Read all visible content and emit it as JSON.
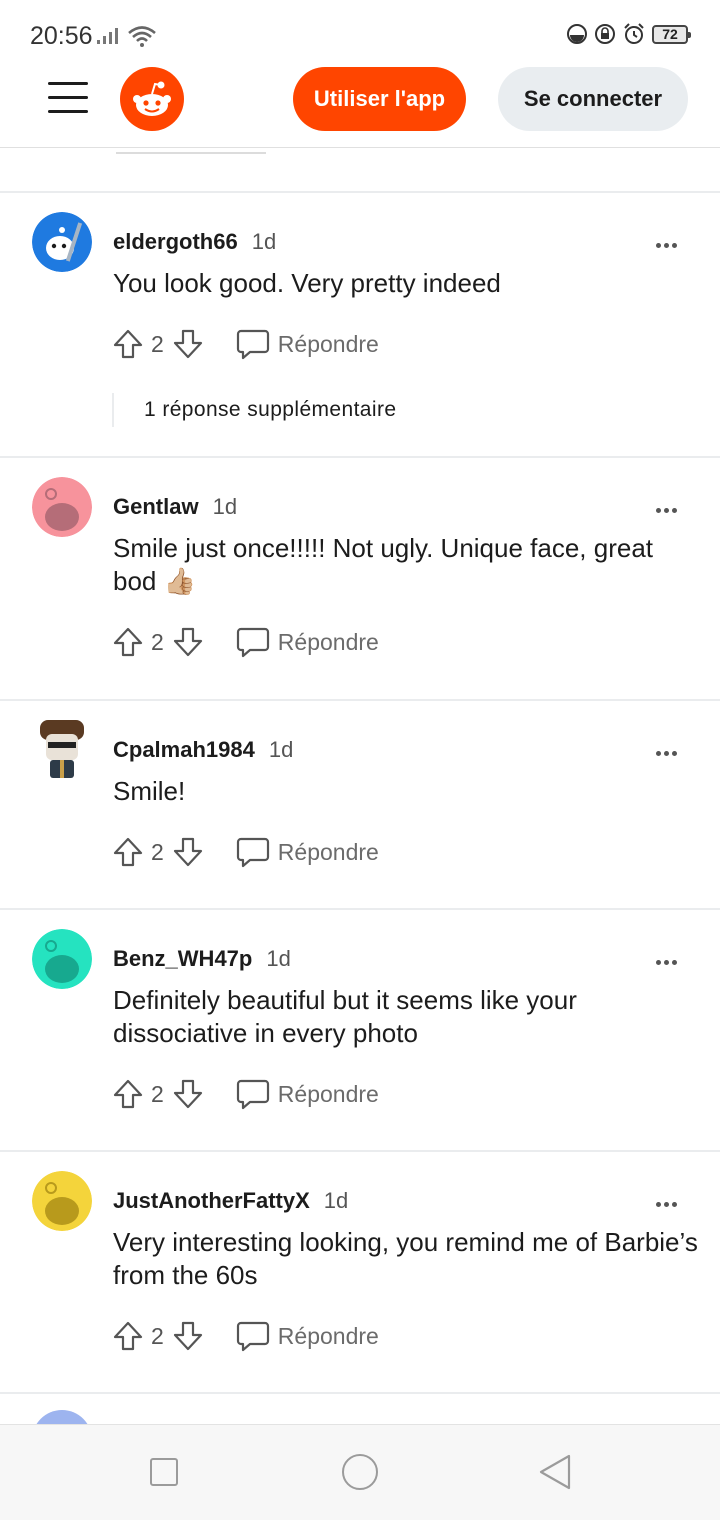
{
  "status_bar": {
    "time": "20:56",
    "battery": "72"
  },
  "header": {
    "use_app_label": "Utiliser l'app",
    "login_label": "Se connecter"
  },
  "reply_label": "Répondre",
  "comments": [
    {
      "username": "eldergoth66",
      "age": "1d",
      "body": "You look good. Very pretty indeed",
      "score": "2",
      "more_replies": "1 réponse supplémentaire",
      "avatar_color": "#1f7ae0"
    },
    {
      "username": "Gentlaw",
      "age": "1d",
      "body": "Smile just once!!!!! Not ugly. Unique face, great bod 👍🏼",
      "score": "2",
      "avatar_color": "#f7939c"
    },
    {
      "username": "Cpalmah1984",
      "age": "1d",
      "body": "Smile!",
      "score": "2",
      "avatar_color": "#ffffff"
    },
    {
      "username": "Benz_WH47p",
      "age": "1d",
      "body": "Definitely beautiful but it seems like your dissociative in every photo",
      "score": "2",
      "avatar_color": "#25e3c0"
    },
    {
      "username": "JustAnotherFattyX",
      "age": "1d",
      "body": "Very interesting looking, you remind me of Barbie’s from the 60s",
      "score": "2",
      "avatar_color": "#f4d43b"
    }
  ],
  "colors": {
    "brand": "#ff4500",
    "login_bg": "#e9edf0",
    "divider": "#eaecee"
  }
}
